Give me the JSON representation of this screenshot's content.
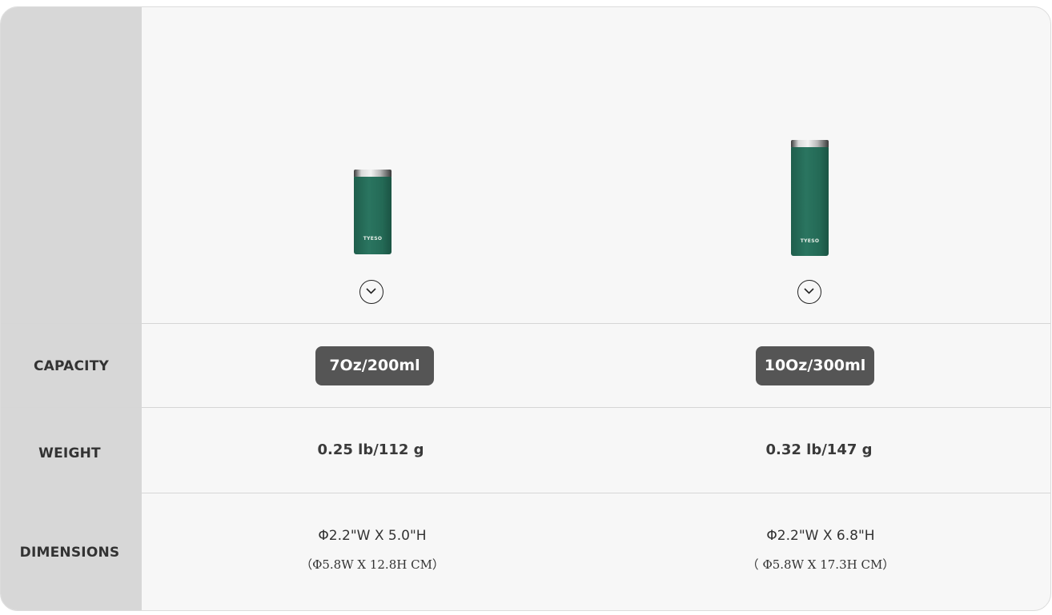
{
  "rows": {
    "capacity_label": "CAPACITY",
    "weight_label": "WEIGHT",
    "dimensions_label": "DIMENSIONS"
  },
  "products": [
    {
      "brand": "TYESO",
      "capacity": "7Oz/200ml",
      "weight": "0.25 lb/112 g",
      "dimensions_imperial": "Φ2.2\"W X 5.0\"H",
      "dimensions_metric": "（Φ5.8W X 12.8H  CM）",
      "bottle_color": "#246a56"
    },
    {
      "brand": "TYESO",
      "capacity": "10Oz/300ml",
      "weight": "0.32 lb/147 g",
      "dimensions_imperial": "Φ2.2\"W X 6.8\"H",
      "dimensions_metric": "（ Φ5.8W X 17.3H  CM）",
      "bottle_color": "#246a56"
    }
  ],
  "icons": {
    "expand": "chevron-down-icon"
  },
  "colors": {
    "sidebar": "#d7d7d7",
    "panel": "#f7f7f7",
    "pill": "#555555",
    "text": "#333333"
  }
}
